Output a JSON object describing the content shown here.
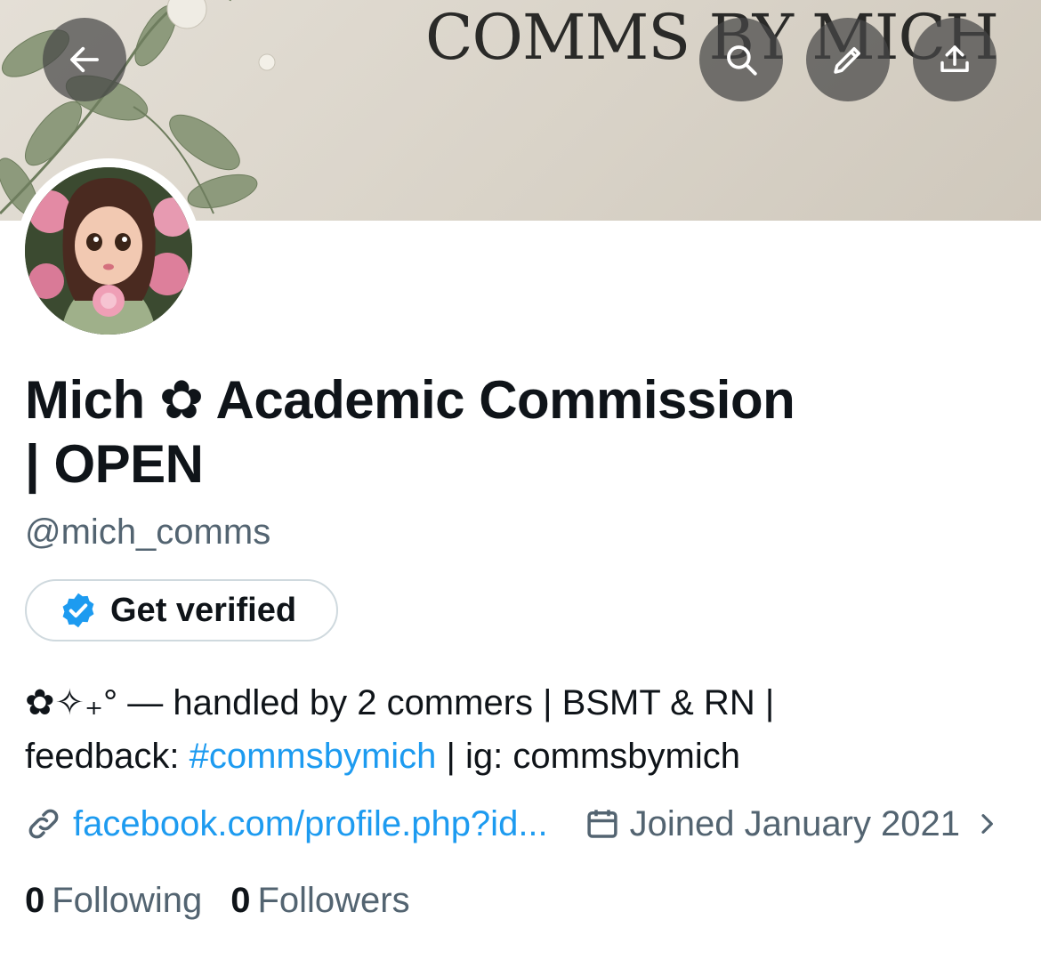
{
  "header": {
    "banner_title": "COMMS BY MICH"
  },
  "icons": {
    "back": "arrow-left-icon",
    "search": "search-icon",
    "edit": "pencil-icon",
    "share": "share-upload-icon"
  },
  "profile": {
    "display_name_line1": "Mich ✿ Academic Commission",
    "display_name_line2": "| OPEN",
    "handle": "@mich_comms",
    "verify_label": "Get verified",
    "bio": {
      "line1": "✿✧₊° — handled by 2 commers | BSMT & RN |",
      "line2_prefix": "feedback: ",
      "line2_tag": "#commsbymich",
      "line2_suffix": " | ig: commsbymich"
    },
    "link": "facebook.com/profile.php?id...",
    "joined": "Joined January 2021",
    "following_count": "0",
    "following_label": "Following",
    "followers_count": "0",
    "followers_label": "Followers"
  },
  "colors": {
    "accent": "#1d9bf0",
    "secondary_text": "#536471",
    "primary_text": "#0f1419"
  }
}
